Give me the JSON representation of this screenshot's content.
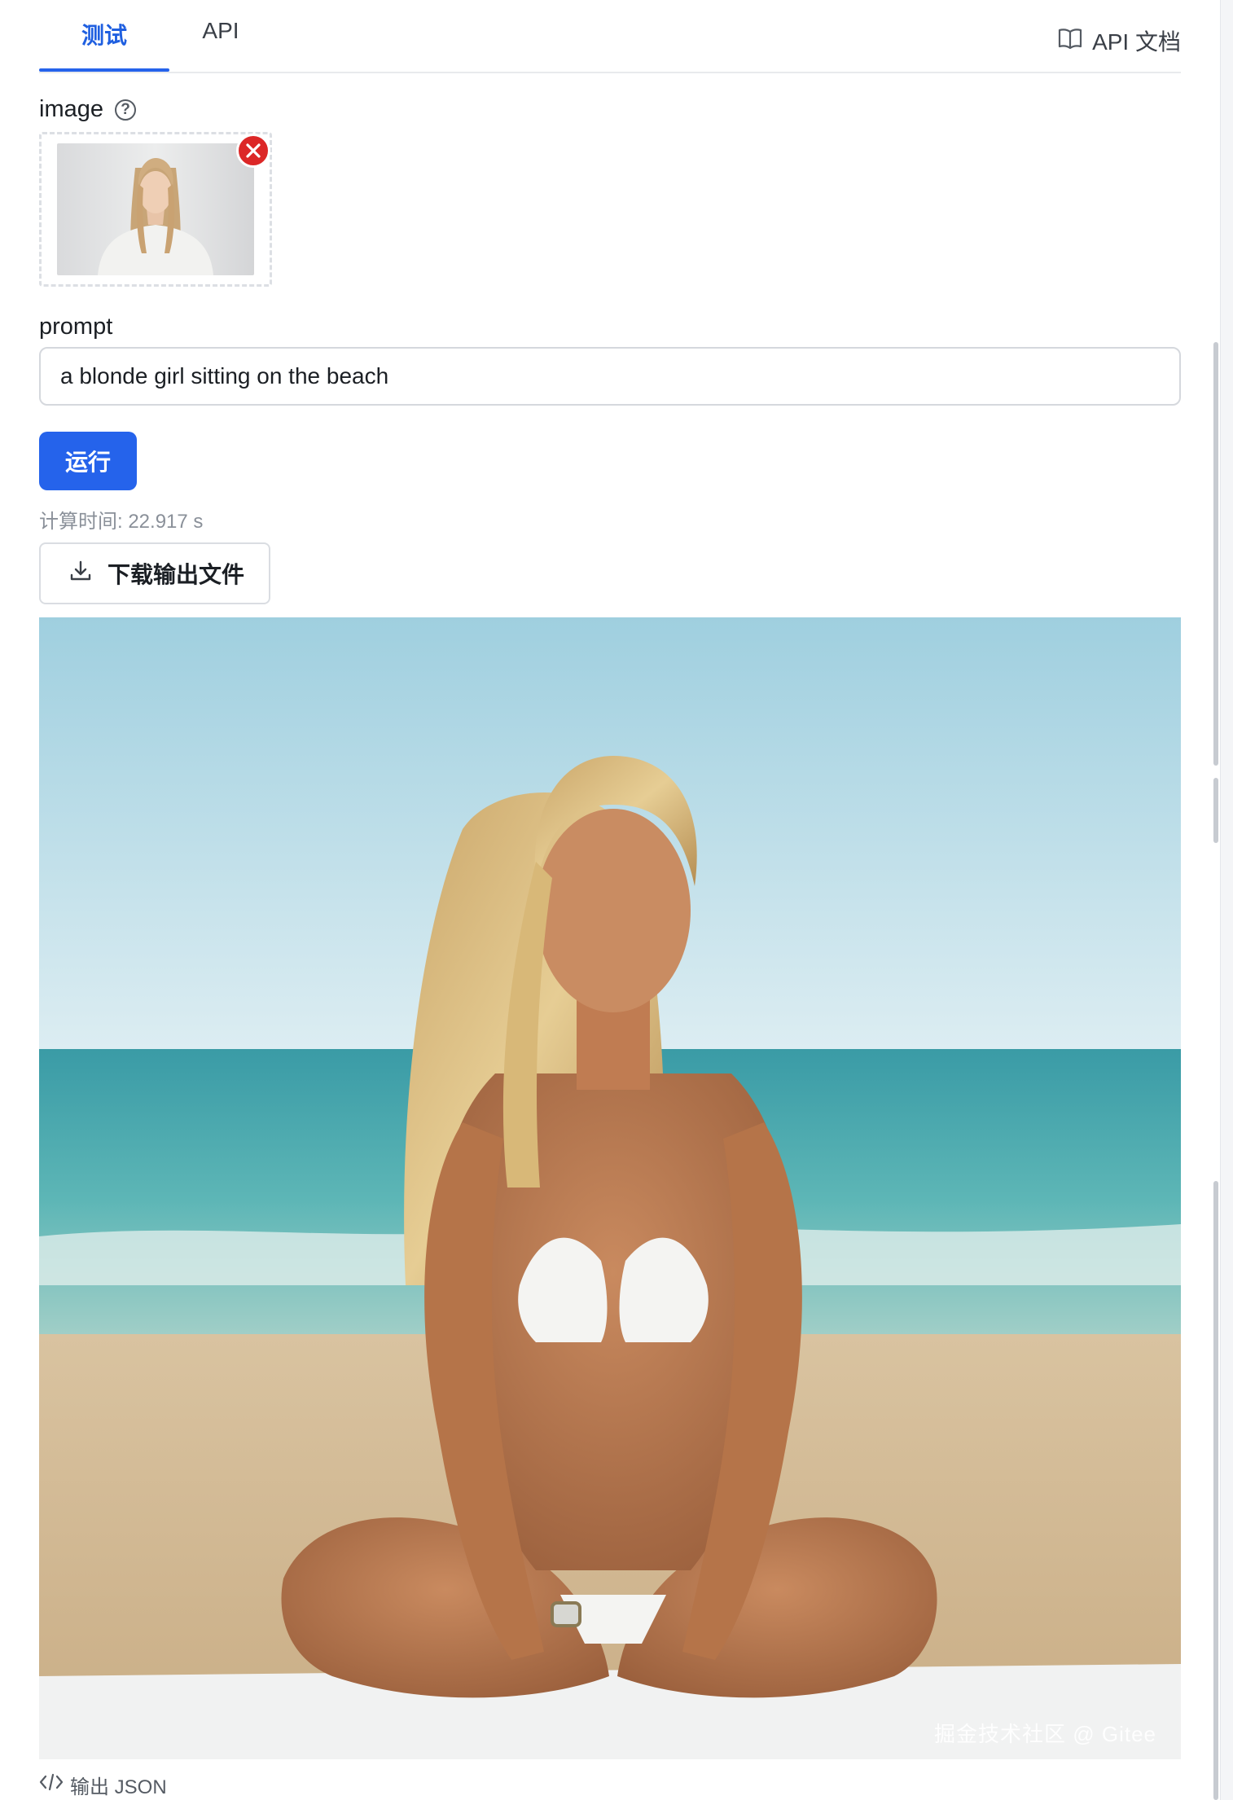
{
  "tabs": [
    {
      "label": "测试",
      "active": true
    },
    {
      "label": "API",
      "active": false
    }
  ],
  "docs_link": {
    "label": "API 文档",
    "icon": "book-open-icon"
  },
  "image_field": {
    "label": "image",
    "help_icon": "?"
  },
  "prompt_field": {
    "label": "prompt",
    "value": "a blonde girl sitting on the beach"
  },
  "run_button": {
    "label": "运行"
  },
  "compute_time": "计算时间: 22.917 s",
  "download_button": {
    "label": "下载输出文件",
    "icon": "download-icon"
  },
  "output": {
    "watermark": "掘金技术社区 @ Gitee"
  },
  "json_link": {
    "label": "输出 JSON",
    "icon": "code-icon"
  },
  "colors": {
    "accent": "#2563eb",
    "danger": "#dc2727",
    "muted": "#8a9099"
  }
}
